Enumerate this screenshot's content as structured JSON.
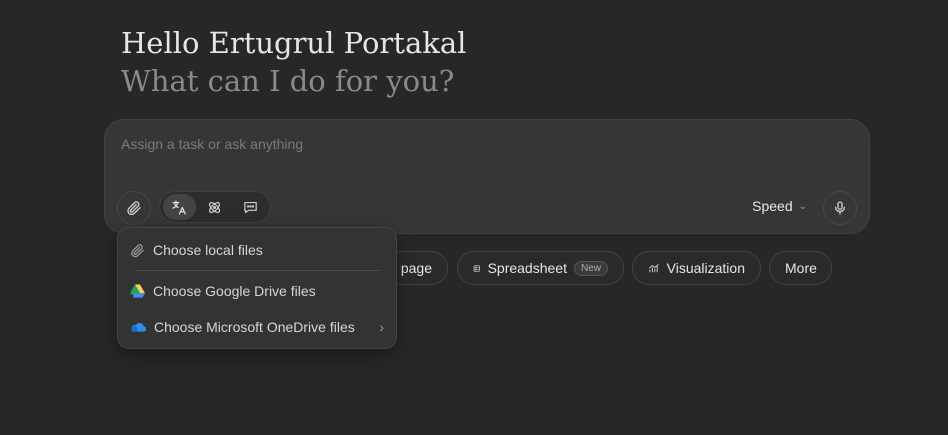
{
  "greeting": {
    "title": "Hello Ertugrul Portakal",
    "subtitle": "What can I do for you?"
  },
  "composer": {
    "placeholder": "Assign a task or ask anything",
    "speed_label": "Speed"
  },
  "chips": [
    {
      "label": "page",
      "icon": "webpage-icon"
    },
    {
      "label": "Spreadsheet",
      "icon": "table-icon",
      "badge": "New"
    },
    {
      "label": "Visualization",
      "icon": "chart-icon"
    },
    {
      "label": "More"
    }
  ],
  "attach_menu": {
    "items": [
      {
        "label": "Choose local files",
        "icon": "paperclip-icon"
      },
      {
        "label": "Choose Google Drive files",
        "icon": "google-drive-icon"
      },
      {
        "label": "Choose Microsoft OneDrive files",
        "icon": "onedrive-icon",
        "has_submenu": true
      }
    ]
  },
  "colors": {
    "background": "#272727",
    "panel": "#363637",
    "menu": "#333334",
    "drive_green": "#1FA463",
    "drive_yellow": "#FFD04B",
    "drive_blue": "#4688F4",
    "onedrive_blue": "#2F8FE8"
  }
}
